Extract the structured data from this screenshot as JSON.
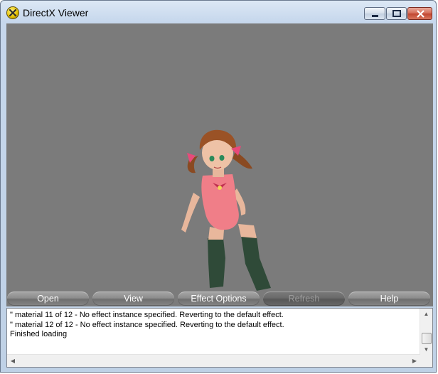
{
  "window": {
    "title": "DirectX Viewer"
  },
  "buttons": [
    {
      "label": "Open",
      "enabled": true
    },
    {
      "label": "View",
      "enabled": true
    },
    {
      "label": "Effect Options",
      "enabled": true
    },
    {
      "label": "Refresh",
      "enabled": false
    },
    {
      "label": "Help",
      "enabled": true
    }
  ],
  "log": {
    "lines": [
      "\" material 11 of 12 - No effect instance specified. Reverting to the default effect.",
      "\" material 12 of 12 - No effect instance specified. Reverting to the default effect.",
      "Finished loading"
    ]
  },
  "colors": {
    "viewport_bg": "#7b7b7b",
    "button_pill": "#8d8d8d"
  }
}
